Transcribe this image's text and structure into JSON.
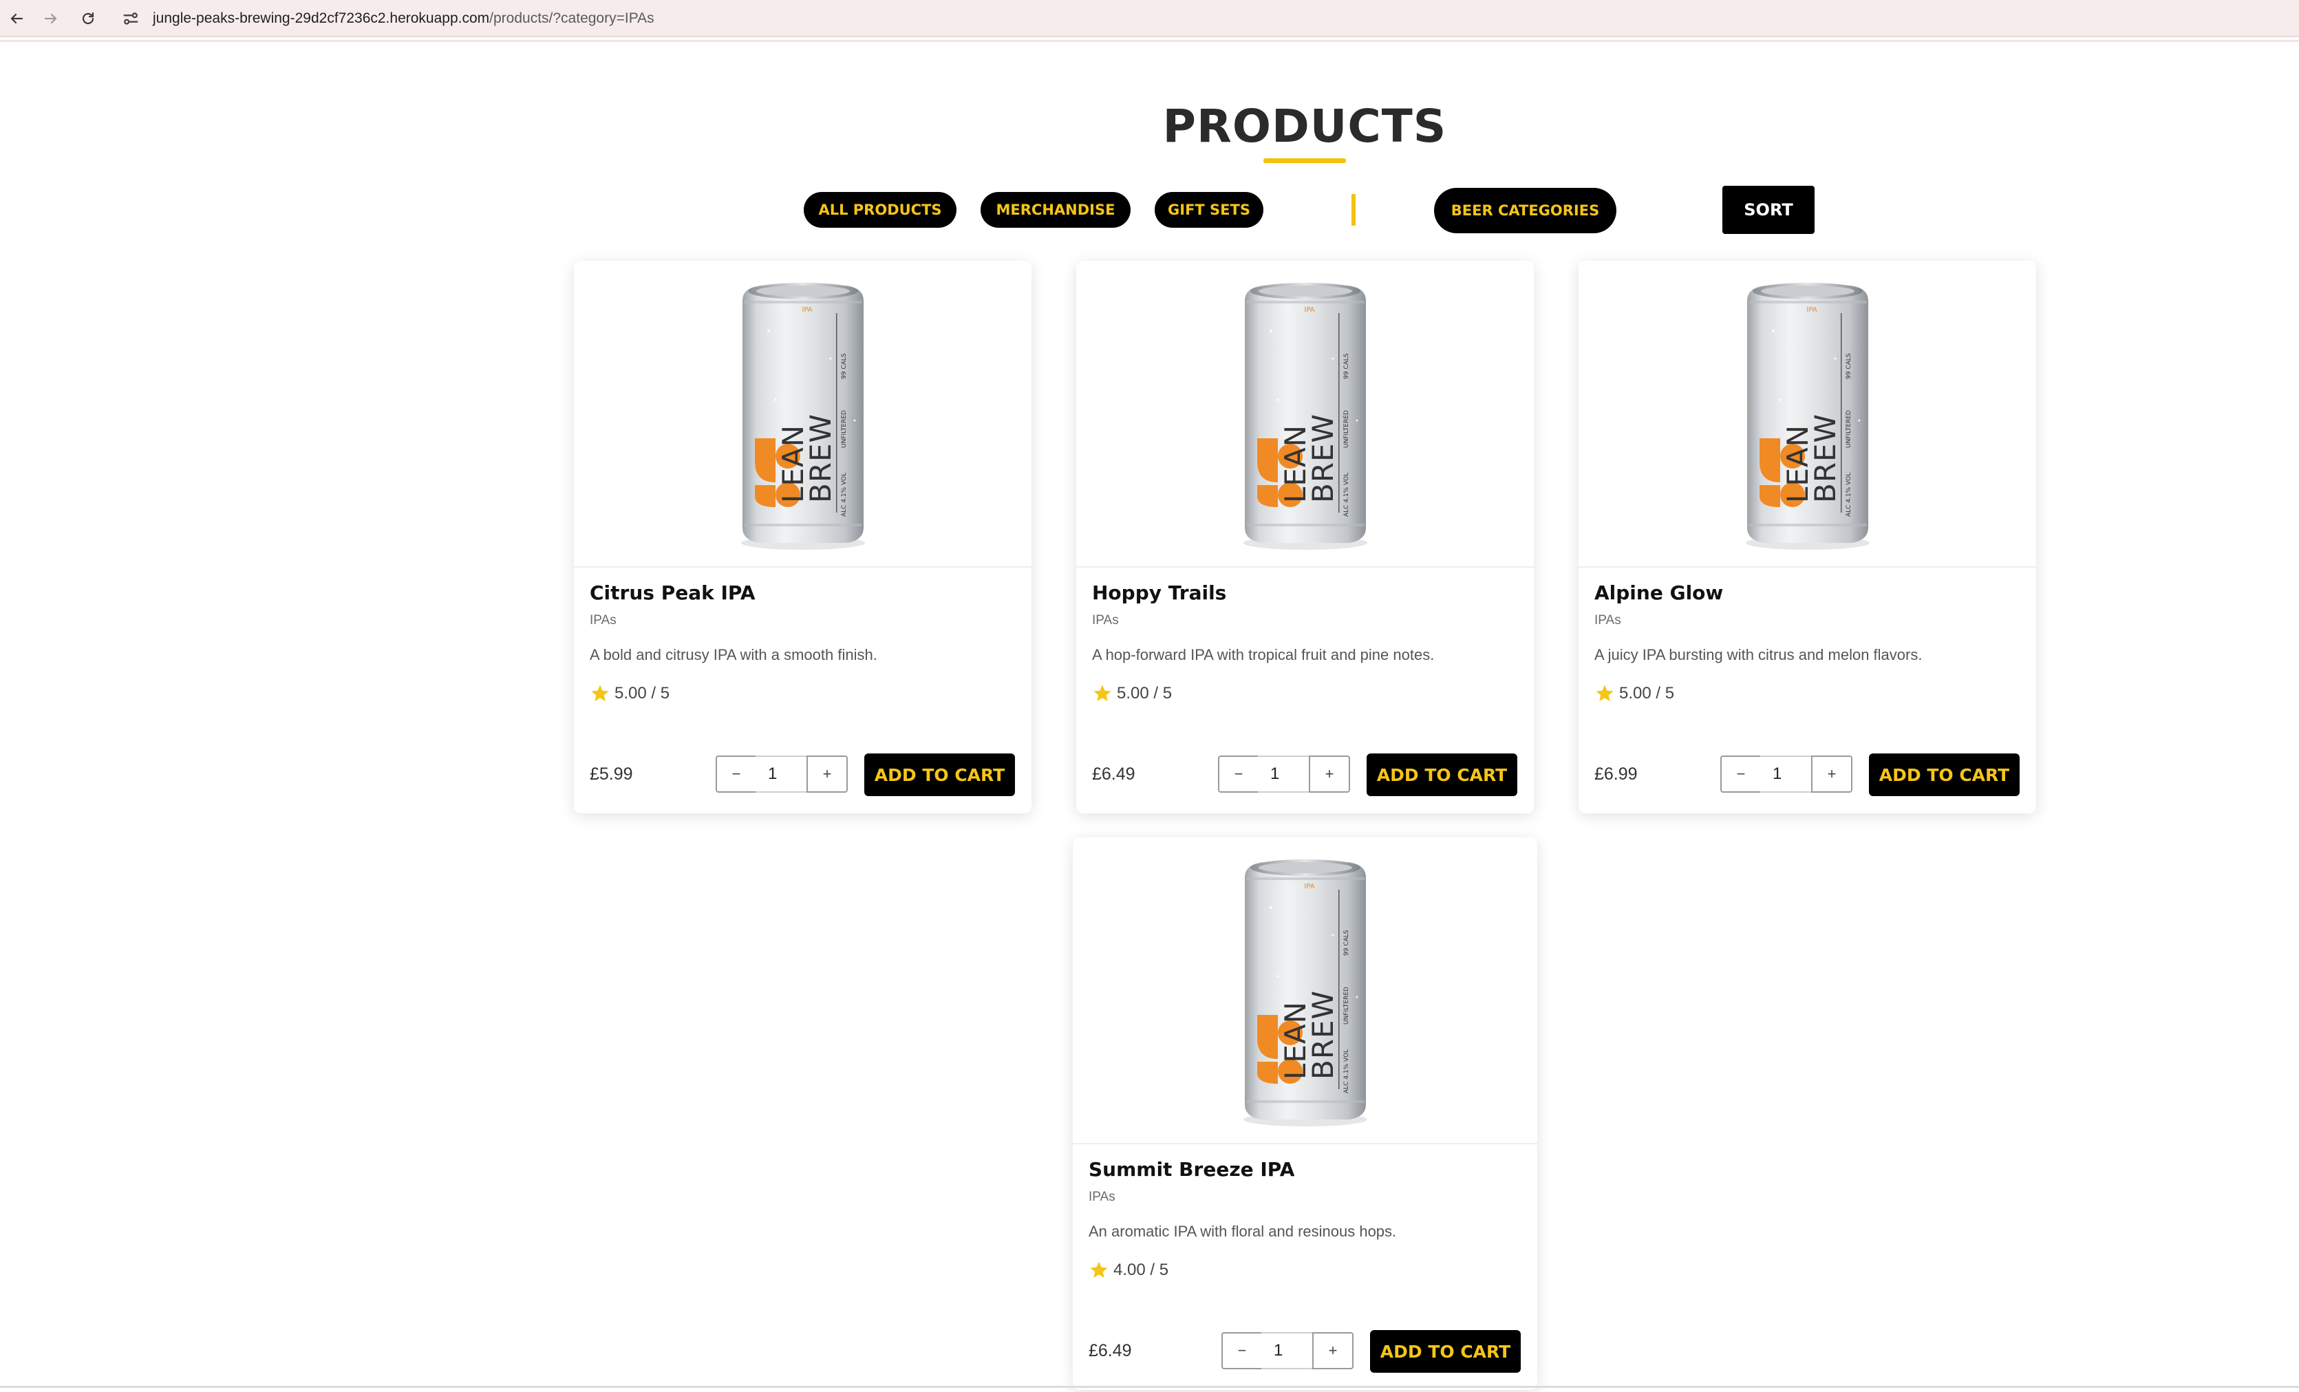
{
  "browser": {
    "url_host": "jungle-peaks-brewing-29d2cf7236c2.herokuapp.com",
    "url_path": "/products/?category=IPAs"
  },
  "header": {
    "title": "PRODUCTS"
  },
  "filters": {
    "all_products": "ALL PRODUCTS",
    "merchandise": "MERCHANDISE",
    "gift_sets": "GIFT SETS",
    "beer_categories": "BEER CATEGORIES",
    "sort": "SORT"
  },
  "colors": {
    "accent": "#f5c518",
    "button_bg": "#000000",
    "can_orange": "#f08a24"
  },
  "can_label": {
    "line1": "LEAN",
    "line2": "BREW",
    "side1": "99 CALS",
    "side2": "UNFILTERED",
    "side3": "ALC 4.1% VOL"
  },
  "products": [
    {
      "name": "Citrus Peak IPA",
      "category": "IPAs",
      "description": "A bold and citrusy IPA with a smooth finish.",
      "rating": "5.00 / 5",
      "price": "£5.99",
      "quantity": "1",
      "minus": "−",
      "plus": "+",
      "add_label": "ADD TO CART"
    },
    {
      "name": "Hoppy Trails",
      "category": "IPAs",
      "description": "A hop-forward IPA with tropical fruit and pine notes.",
      "rating": "5.00 / 5",
      "price": "£6.49",
      "quantity": "1",
      "minus": "−",
      "plus": "+",
      "add_label": "ADD TO CART"
    },
    {
      "name": "Alpine Glow",
      "category": "IPAs",
      "description": "A juicy IPA bursting with citrus and melon flavors.",
      "rating": "5.00 / 5",
      "price": "£6.99",
      "quantity": "1",
      "minus": "−",
      "plus": "+",
      "add_label": "ADD TO CART"
    },
    {
      "name": "Summit Breeze IPA",
      "category": "IPAs",
      "description": "An aromatic IPA with floral and resinous hops.",
      "rating": "4.00 / 5",
      "price": "£6.49",
      "quantity": "1",
      "minus": "−",
      "plus": "+",
      "add_label": "ADD TO CART"
    }
  ]
}
